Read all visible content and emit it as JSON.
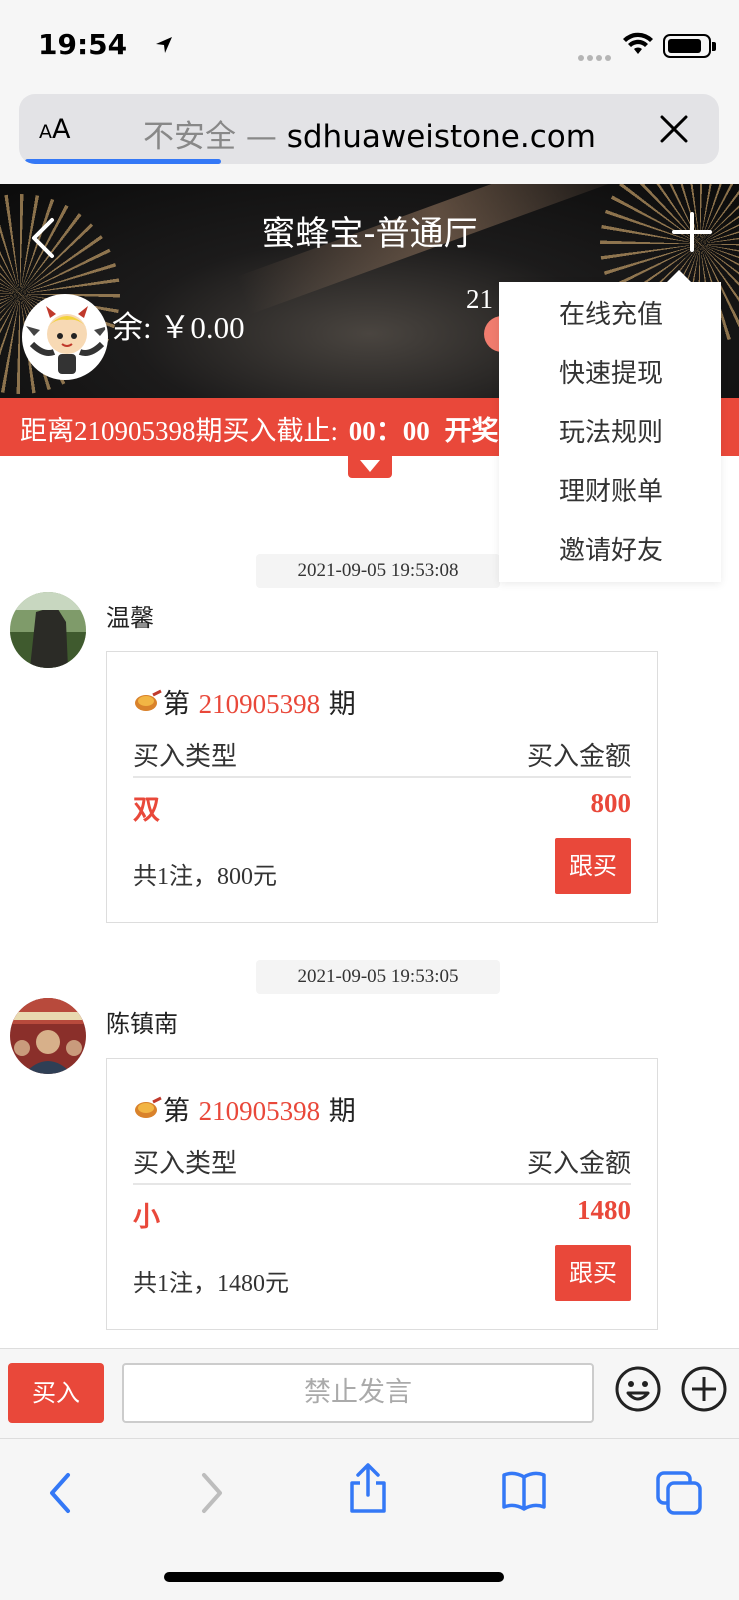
{
  "status_bar": {
    "time": "19:54"
  },
  "browser": {
    "text_size_label_small": "A",
    "text_size_label_large": "A",
    "security_label": "不安全 —",
    "domain": "sdhuaweistone.com",
    "load_progress": 0.28
  },
  "header": {
    "title": "蜜蜂宝-普通厅",
    "balance": "余: ￥0.00",
    "issue_partial": "21"
  },
  "deadline_bar": {
    "prefix": "距离210905398期买入截止:",
    "countdown": "00：00",
    "suffix": "开奖"
  },
  "dropdown_menu": {
    "items": [
      "在线充值",
      "快速提现",
      "玩法规则",
      "理财账单",
      "邀请好友"
    ]
  },
  "messages": [
    {
      "timestamp": "2021-09-05 19:53:08",
      "user": "温馨",
      "issue_prefix": "第",
      "issue_number": "210905398",
      "issue_suffix": "期",
      "col_type": "买入类型",
      "col_amount": "买入金额",
      "bet_type": "双",
      "bet_amount": "800",
      "summary": "共1注，800元",
      "follow_label": "跟买"
    },
    {
      "timestamp": "2021-09-05 19:53:05",
      "user": "陈镇南",
      "issue_prefix": "第",
      "issue_number": "210905398",
      "issue_suffix": "期",
      "col_type": "买入类型",
      "col_amount": "买入金额",
      "bet_type": "小",
      "bet_amount": "1480",
      "summary": "共1注，1480元",
      "follow_label": "跟买"
    }
  ],
  "input_bar": {
    "buy_label": "买入",
    "placeholder": "禁止发言"
  },
  "colors": {
    "accent": "#e9483a",
    "link_blue": "#3478f6"
  }
}
